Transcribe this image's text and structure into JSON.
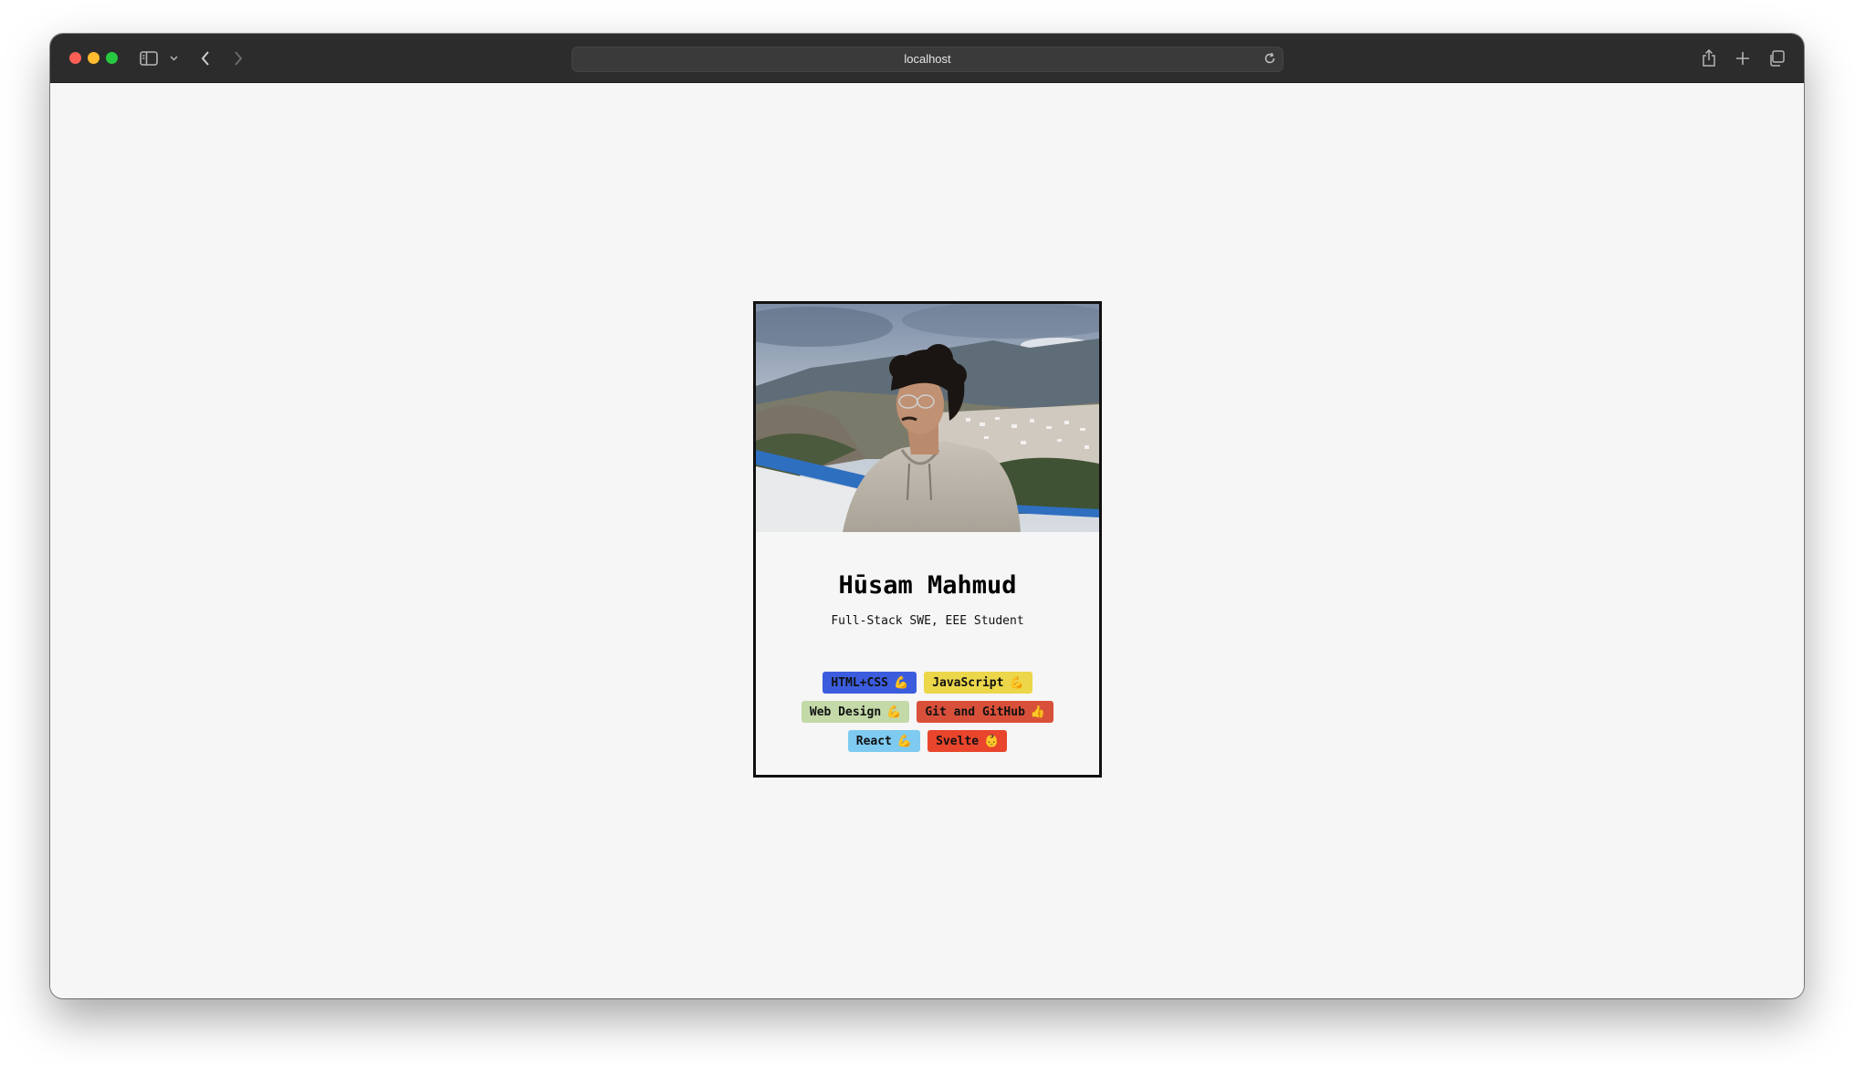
{
  "browser": {
    "url": "localhost"
  },
  "profile": {
    "name": "Hūsam Mahmud",
    "role": "Full-Stack SWE, EEE Student"
  },
  "skills": [
    [
      {
        "label": "HTML+CSS",
        "emoji": "💪",
        "color": "#3b5ddd"
      },
      {
        "label": "JavaScript",
        "emoji": "💪",
        "color": "#ecd64a"
      }
    ],
    [
      {
        "label": "Web Design",
        "emoji": "💪",
        "color": "#c3d9a8"
      },
      {
        "label": "Git and GitHub",
        "emoji": "👍",
        "color": "#d9503a"
      }
    ],
    [
      {
        "label": "React",
        "emoji": "💪",
        "color": "#7ecaf0"
      },
      {
        "label": "Svelte",
        "emoji": "👶",
        "color": "#e8452c"
      }
    ]
  ]
}
